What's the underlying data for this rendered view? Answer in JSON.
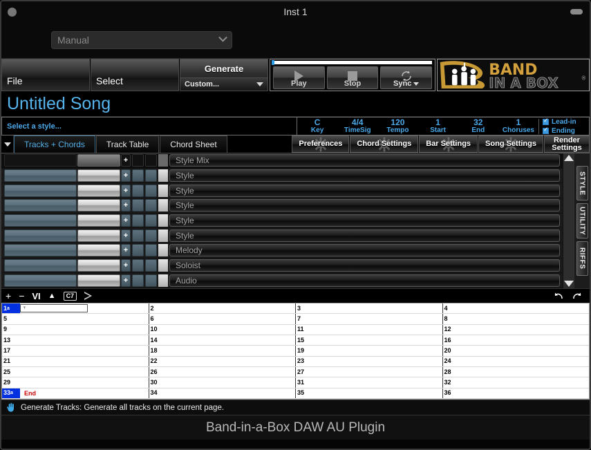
{
  "window": {
    "title": "Inst 1",
    "dot_icon": "window-dot",
    "pill_icon": "resize-pill"
  },
  "mode": {
    "value": "Manual",
    "chevron_icon": "chevron-down-icon"
  },
  "menu": {
    "file": "File",
    "select": "Select",
    "generate_title": "Generate",
    "generate_value": "Custom...",
    "caret_icon": "caret-down-icon"
  },
  "transport": {
    "play": "Play",
    "stop": "Stop",
    "sync": "Sync",
    "play_icon": "play-icon",
    "stop_icon": "stop-icon",
    "sync_icon": "sync-loop-icon",
    "caret_icon": "caret-down-icon"
  },
  "logo": {
    "line1": "BAND",
    "line2": "IN A BOX",
    "mark": "B",
    "registered": "®",
    "gold": "#d2a03c"
  },
  "song": {
    "title": "Untitled Song",
    "title_color": "#56b4ec"
  },
  "style_field": {
    "placeholder": "Select a style..."
  },
  "info": [
    {
      "value": "C",
      "label": "Key"
    },
    {
      "value": "4/4",
      "label": "TimeSig"
    },
    {
      "value": "120",
      "label": "Tempo"
    },
    {
      "value": "1",
      "label": "Start"
    },
    {
      "value": "32",
      "label": "End"
    },
    {
      "value": "1",
      "label": "Choruses"
    }
  ],
  "checkboxes": [
    {
      "label": "Lead-in",
      "checked": true
    },
    {
      "label": "Ending",
      "checked": true
    }
  ],
  "tabs": {
    "menu_icon": "triangle-down-icon",
    "items": [
      {
        "label": "Tracks + Chords",
        "active": true
      },
      {
        "label": "Track Table",
        "active": false
      },
      {
        "label": "Chord Sheet",
        "active": false
      }
    ]
  },
  "settings_buttons": [
    {
      "label": "Preferences",
      "icon": "gear-icon"
    },
    {
      "label": "Chord Settings",
      "icon": "gear-icon"
    },
    {
      "label": "Bar Settings",
      "icon": "gear-icon"
    },
    {
      "label": "Song Settings",
      "icon": "gear-icon"
    },
    {
      "label": "Render Settings",
      "icon": "gear-icon",
      "two_line": true
    }
  ],
  "tracks": {
    "header_row": {
      "style_label": "Style Mix",
      "plus": "+"
    },
    "rows": [
      {
        "style_label": "Style",
        "plus": "+"
      },
      {
        "style_label": "Style",
        "plus": "+"
      },
      {
        "style_label": "Style",
        "plus": "+"
      },
      {
        "style_label": "Style",
        "plus": "+"
      },
      {
        "style_label": "Style",
        "plus": "+"
      },
      {
        "style_label": "Melody",
        "plus": "+"
      },
      {
        "style_label": "Soloist",
        "plus": "+"
      },
      {
        "style_label": "Audio",
        "plus": "+"
      }
    ],
    "scroll_up_icon": "scroll-up-arrow",
    "scroll_down_icon": "scroll-down-arrow",
    "side_tabs": [
      {
        "label": "STYLE"
      },
      {
        "label": "UTILITY"
      },
      {
        "label": "RIFFS"
      }
    ]
  },
  "chord_toolbar": {
    "add": "+",
    "remove": "−",
    "roman": "VI",
    "up_arrow": "▲",
    "chord_chip": "C7",
    "play_icon": "play-outline-icon",
    "undo_icon": "undo-arrow-icon",
    "redo_icon": "redo-arrow-icon"
  },
  "chord_sheet": {
    "rows": [
      [
        {
          "bar": "1",
          "sub": "a",
          "highlight": true,
          "editing": true,
          "value": ""
        },
        {
          "bar": "2"
        },
        {
          "bar": "3"
        },
        {
          "bar": "4"
        }
      ],
      [
        {
          "bar": "5"
        },
        {
          "bar": "6"
        },
        {
          "bar": "7"
        },
        {
          "bar": "8"
        }
      ],
      [
        {
          "bar": "9"
        },
        {
          "bar": "10"
        },
        {
          "bar": "11"
        },
        {
          "bar": "12"
        }
      ],
      [
        {
          "bar": "13"
        },
        {
          "bar": "14"
        },
        {
          "bar": "15"
        },
        {
          "bar": "16"
        }
      ],
      [
        {
          "bar": "17"
        },
        {
          "bar": "18"
        },
        {
          "bar": "19"
        },
        {
          "bar": "20"
        }
      ],
      [
        {
          "bar": "21"
        },
        {
          "bar": "22"
        },
        {
          "bar": "23"
        },
        {
          "bar": "24"
        }
      ],
      [
        {
          "bar": "25"
        },
        {
          "bar": "26"
        },
        {
          "bar": "27"
        },
        {
          "bar": "28"
        }
      ],
      [
        {
          "bar": "29"
        },
        {
          "bar": "30"
        },
        {
          "bar": "31"
        },
        {
          "bar": "32"
        }
      ],
      [
        {
          "bar": "33",
          "sub": "a",
          "highlight": true,
          "marker": "End"
        },
        {
          "bar": "34"
        },
        {
          "bar": "35"
        },
        {
          "bar": "36"
        }
      ]
    ]
  },
  "status": {
    "icon": "hand-pointer-icon",
    "text": "Generate Tracks: Generate all tracks on the current page."
  },
  "footer": {
    "text": "Band-in-a-Box DAW AU Plugin"
  }
}
